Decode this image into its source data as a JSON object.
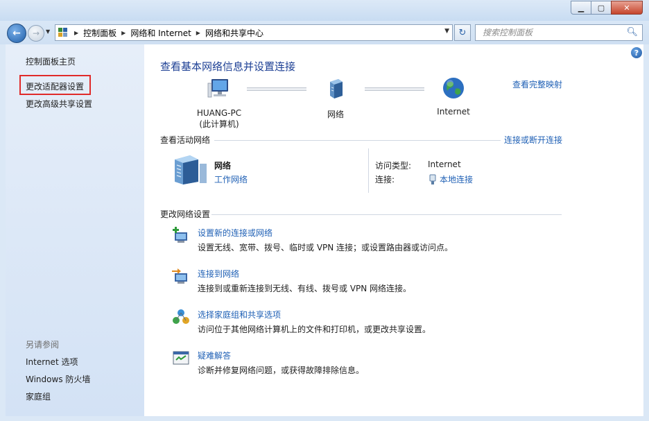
{
  "window": {
    "minimize_label": "▁",
    "maximize_label": "▢",
    "close_label": "✕"
  },
  "navbar": {
    "breadcrumbs": [
      "控制面板",
      "网络和 Internet",
      "网络和共享中心"
    ],
    "search_placeholder": "搜索控制面板"
  },
  "sidebar": {
    "items": [
      {
        "label": "控制面板主页"
      },
      {
        "label": "更改适配器设置"
      },
      {
        "label": "更改高级共享设置"
      }
    ],
    "see_also_title": "另请参阅",
    "see_also": [
      {
        "label": "Internet 选项"
      },
      {
        "label": "Windows 防火墙"
      },
      {
        "label": "家庭组"
      }
    ],
    "highlight_color": "#e02a2a"
  },
  "main": {
    "heading": "查看基本网络信息并设置连接",
    "full_map_link": "查看完整映射",
    "nodes": [
      {
        "name": "HUANG-PC",
        "sub": "(此计算机)",
        "icon": "computer-icon"
      },
      {
        "name": "网络",
        "icon": "network-icon"
      },
      {
        "name": "Internet",
        "icon": "globe-icon"
      }
    ],
    "active_title": "查看活动网络",
    "connect_link": "连接或断开连接",
    "active_network": {
      "name": "网络",
      "type_link": "工作网络",
      "access_type_label": "访问类型:",
      "access_type_value": "Internet",
      "connection_label": "连接:",
      "connection_value": "本地连接"
    },
    "change_title": "更改网络设置",
    "tasks": [
      {
        "title": "设置新的连接或网络",
        "desc": "设置无线、宽带、拨号、临时或 VPN 连接；或设置路由器或访问点。",
        "icon": "new-connection-icon"
      },
      {
        "title": "连接到网络",
        "desc": "连接到或重新连接到无线、有线、拨号或 VPN 网络连接。",
        "icon": "connect-network-icon"
      },
      {
        "title": "选择家庭组和共享选项",
        "desc": "访问位于其他网络计算机上的文件和打印机，或更改共享设置。",
        "icon": "homegroup-icon"
      },
      {
        "title": "疑难解答",
        "desc": "诊断并修复网络问题，或获得故障排除信息。",
        "icon": "troubleshoot-icon"
      }
    ]
  },
  "colors": {
    "link": "#1f60b5",
    "heading": "#1c3f94",
    "sidebar_bg": "#dfeaf8"
  }
}
